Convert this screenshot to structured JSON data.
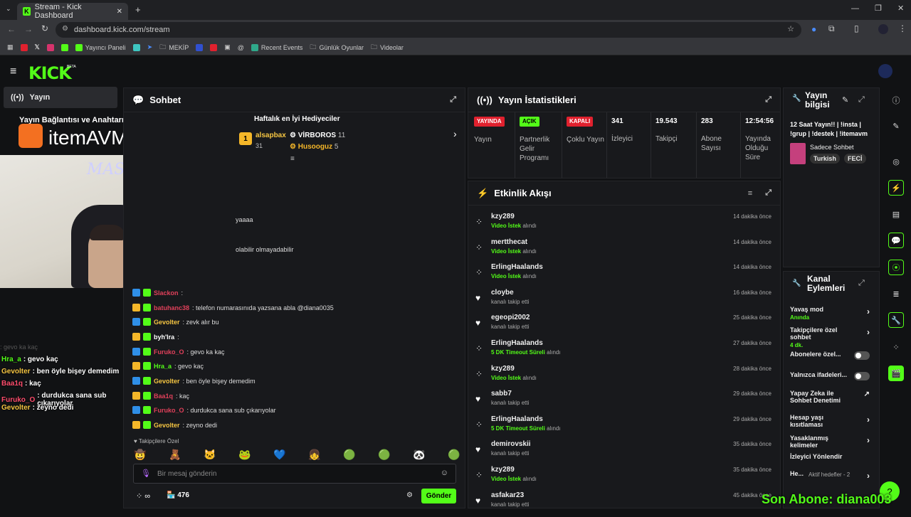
{
  "browser": {
    "tab_title": "Stream - Kick Dashboard",
    "url": "dashboard.kick.com/stream",
    "bookmarks": [
      "Yayıncı Paneli",
      "MEKİP",
      "Recent Events",
      "Günlük Oyunlar",
      "Videolar"
    ]
  },
  "header": {
    "logo": "KICK",
    "beta": "BETA"
  },
  "sidebar": {
    "active_item": "Yayın",
    "item2": "Yayın Bağlantısı ve Anahtarı"
  },
  "overlay": {
    "brand": "itemAVM",
    "cam_sign": "MASKAR",
    "side_chat": [
      {
        "user": "Hra_a",
        "msg": ": gevo kaç",
        "ucolor": "#53fc18"
      },
      {
        "user": "Gevolter",
        "msg": ": ben öyle bişey demedim",
        "ucolor": "#f5c542"
      },
      {
        "user": "Baa1q",
        "msg": ": kaç",
        "ucolor": "#ff4d6d"
      },
      {
        "user": "Furuko_O",
        "msg": ": durdukca sana sub çıkarıyolar",
        "ucolor": "#ff4d6d"
      },
      {
        "user": "Gevolter",
        "msg": ": zeyno dedi",
        "ucolor": "#f5c542"
      }
    ],
    "faded_line": ": gevo ka kaç",
    "last_sub": "Son Abone: diana003"
  },
  "chat": {
    "title": "Sohbet",
    "gifters_title": "Haftalık en İyi Hediyeciler",
    "gifters": [
      {
        "rank": "1",
        "name": "alsapbax",
        "count": "31"
      },
      {
        "name": "VİRBOROS",
        "count": "11"
      },
      {
        "name": "Husooguz",
        "count": "5"
      }
    ],
    "partial_lines": [
      "yaaaa",
      "olabilir olmayadabilir"
    ],
    "messages": [
      {
        "user": "Slackon",
        "msg": ":",
        "ucolor": "#e0405a"
      },
      {
        "user": "batuhanc38",
        "msg": ": telefon numarasınıda yazsana abla @diana0035",
        "ucolor": "#e0405a"
      },
      {
        "user": "Gevolter",
        "msg": ": zevk alır bu",
        "ucolor": "#f5c542"
      },
      {
        "user": "byh'lra",
        "msg": ":",
        "ucolor": "#ffffff"
      },
      {
        "user": "Furuko_O",
        "msg": ": gevo ka kaç",
        "ucolor": "#e0405a"
      },
      {
        "user": "Hra_a",
        "msg": ": gevo kaç",
        "ucolor": "#53fc18"
      },
      {
        "user": "Gevolter",
        "msg": ": ben öyle bişey demedim",
        "ucolor": "#f5c542"
      },
      {
        "user": "Baa1q",
        "msg": ": kaç",
        "ucolor": "#e0405a"
      },
      {
        "user": "Furuko_O",
        "msg": ": durdukca sana sub çıkarıyolar",
        "ucolor": "#e0405a"
      },
      {
        "user": "Gevolter",
        "msg": ": zeyno dedi",
        "ucolor": "#f5c542"
      }
    ],
    "emote_section": "Takipçilere Özel",
    "input_placeholder": "Bir mesaj gönderin",
    "viewer_count": "476",
    "send_label": "Gönder",
    "infinity": "∞"
  },
  "stats": {
    "title": "Yayın İstatistikleri",
    "items": [
      {
        "pill": "YAYINDA",
        "label": "Yayın",
        "pill_color": "#e0212e"
      },
      {
        "pill": "AÇIK",
        "label": "Partnerlik Gelir Programı",
        "pill_color": "#53fc18"
      },
      {
        "pill": "KAPALI",
        "label": "Çoklu Yayın",
        "pill_color": "#e0212e"
      },
      {
        "value": "341",
        "label": "İzleyici"
      },
      {
        "value": "19.543",
        "label": "Takipçi"
      },
      {
        "value": "283",
        "label": "Abone Sayısı"
      },
      {
        "value": "12:54:56",
        "label": "Yayında Olduğu Süre"
      }
    ]
  },
  "events": {
    "title": "Etkinlik Akışı",
    "items": [
      {
        "name": "kzy289",
        "type": "Video İstek",
        "rest": "alındı",
        "time": "14 dakika önce",
        "icon": "share"
      },
      {
        "name": "mertthecat",
        "type": "Video İstek",
        "rest": "alındı",
        "time": "14 dakika önce",
        "icon": "share"
      },
      {
        "name": "ErlingHaalands",
        "type": "Video İstek",
        "rest": "alındı",
        "time": "14 dakika önce",
        "icon": "share"
      },
      {
        "name": "cloybe",
        "type": "",
        "rest": "kanalı takip etti",
        "time": "16 dakika önce",
        "icon": "heart"
      },
      {
        "name": "egeopi2002",
        "type": "",
        "rest": "kanalı takip etti",
        "time": "25 dakika önce",
        "icon": "heart"
      },
      {
        "name": "ErlingHaalands",
        "type": "5 DK Timeout Süreli",
        "rest": "alındı",
        "time": "27 dakika önce",
        "icon": "share"
      },
      {
        "name": "kzy289",
        "type": "Video İstek",
        "rest": "alındı",
        "time": "28 dakika önce",
        "icon": "share"
      },
      {
        "name": "sabb7",
        "type": "",
        "rest": "kanalı takip etti",
        "time": "29 dakika önce",
        "icon": "heart"
      },
      {
        "name": "ErlingHaalands",
        "type": "5 DK Timeout Süreli",
        "rest": "alındı",
        "time": "29 dakika önce",
        "icon": "share"
      },
      {
        "name": "demirovskii",
        "type": "",
        "rest": "kanalı takip etti",
        "time": "35 dakika önce",
        "icon": "heart"
      },
      {
        "name": "kzy289",
        "type": "Video İstek",
        "rest": "alındı",
        "time": "35 dakika önce",
        "icon": "share"
      },
      {
        "name": "asfakar23",
        "type": "",
        "rest": "kanalı takip etti",
        "time": "45 dakika önce",
        "icon": "heart"
      }
    ]
  },
  "streaminfo": {
    "title": "Yayın bilgisi",
    "stream_title": "12 Saat Yayın!! | !insta | !grup | !destek | !itemavm",
    "category": "Sadece Sohbet",
    "tags": [
      "Turkish",
      "FECİ"
    ]
  },
  "channel_actions": {
    "title": "Kanal Eylemleri",
    "items": [
      {
        "label": "Yavaş mod",
        "sub": "Anında",
        "ctrl": "chevron"
      },
      {
        "label": "Takipçilere özel sohbet",
        "sub": "4 dk.",
        "ctrl": "chevron"
      },
      {
        "label": "Abonelere özel...",
        "sub": "",
        "ctrl": "toggle"
      },
      {
        "label": "Yalnızca ifadeleri...",
        "sub": "",
        "ctrl": "toggle"
      },
      {
        "label": "Yapay Zeka ile Sohbet Denetimi",
        "sub": "",
        "ctrl": "external"
      },
      {
        "label": "Hesap yaşı kısıtlaması",
        "sub": "",
        "ctrl": "chevron"
      },
      {
        "label": "Yasaklanmış kelimeler",
        "sub": "",
        "ctrl": "chevron"
      },
      {
        "label": "İzleyici Yönlendir",
        "sub": "",
        "ctrl": "none"
      },
      {
        "label": "He...",
        "sub": "Aktif hedefler - 2",
        "ctrl": "chevron"
      }
    ]
  },
  "colors": {
    "accent": "#53fc18",
    "live": "#e0212e",
    "panel": "#18191c",
    "bg": "#111214"
  }
}
